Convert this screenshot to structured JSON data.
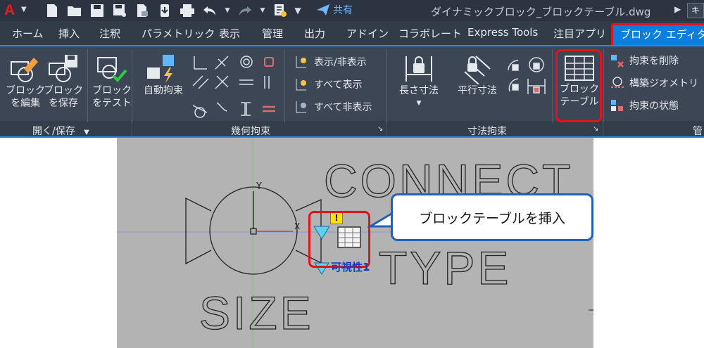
{
  "titlebar": {
    "logo": "A",
    "share_label": "共有",
    "document_title": "ダイナミックブロック_ブロックテーブル.dwg"
  },
  "tabs": [
    "ホーム",
    "挿入",
    "注釈",
    "パラメトリック",
    "表示",
    "管理",
    "出力",
    "アドイン",
    "コラボレート",
    "Express Tools",
    "注目アプリ",
    "ブロック エディタ"
  ],
  "ribbon": {
    "open_save_panel": {
      "title": "開く/保存",
      "edit_block": [
        "ブロック",
        "を編集"
      ],
      "save_block": [
        "ブロック",
        "を保存"
      ],
      "test_block": [
        "ブロック",
        "をテスト"
      ]
    },
    "geometric_panel": {
      "title": "幾何拘束",
      "auto_constrain": "自動拘束",
      "show_hide": "表示/非表示",
      "show_all": "すべて表示",
      "hide_all": "すべて非表示"
    },
    "dimensional_panel": {
      "title": "寸法拘束",
      "linear": "長さ寸法",
      "aligned": "平行寸法"
    },
    "block_table_button": [
      "ブロック",
      "テーブル"
    ],
    "manage_panel": {
      "title": "管",
      "delete_constraints": "拘束を削除",
      "construction_geometry": "構築ジオメトリ",
      "constraint_status": "拘束の状態"
    }
  },
  "canvas": {
    "text_connect": "CONNECT",
    "text_type": "TYPE",
    "text_size": "SIZE",
    "axis_y": "Y",
    "axis_x": "X",
    "visibility_label": "可視性1",
    "warning_mark": "!"
  },
  "callout": {
    "text": "ブロックテーブルを挿入"
  },
  "colors": {
    "accent": "#0a7fe0",
    "highlight": "#e0141a",
    "ribbon": "#3c4654",
    "canvas": "#b3b3b3"
  }
}
